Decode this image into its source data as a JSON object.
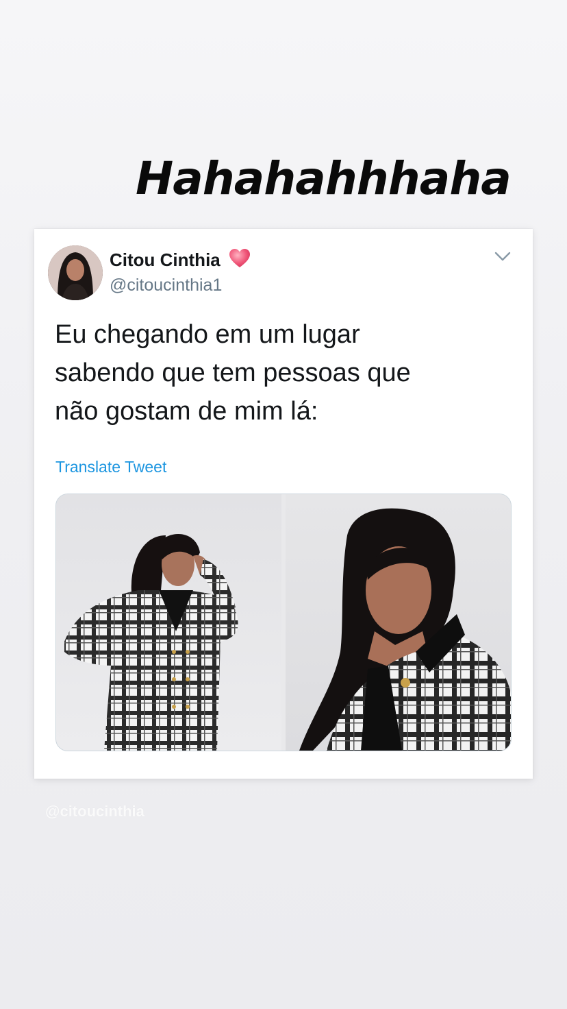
{
  "story": {
    "caption": "Hahahahhhaha",
    "watermark": "@citoucinthia"
  },
  "tweet": {
    "display_name": "Citou Cinthia",
    "handle": "@citoucinthia1",
    "text": "Eu chegando em um lugar\nsabendo que tem pessoas que\nnão gostam de mim lá:",
    "translate_label": "Translate Tweet",
    "icons": {
      "emoji": "heart-emoji-icon",
      "menu": "chevron-down-icon"
    },
    "colors": {
      "link": "#1b95e0",
      "handle": "#657786",
      "text": "#14171a"
    }
  }
}
